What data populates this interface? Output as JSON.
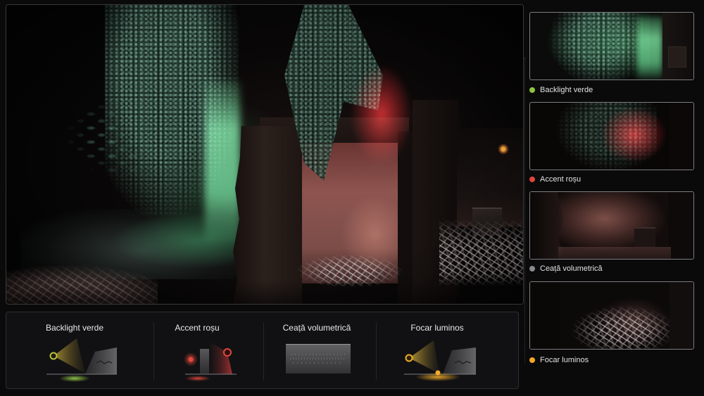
{
  "palette": {
    "background": "#0a0a0b",
    "panel": "#111113",
    "border": "#38383b"
  },
  "diagram_panel": {
    "sections": [
      {
        "label": "Backlight verde",
        "accent": "#b8c23a",
        "icon": "backlight-diagram-icon"
      },
      {
        "label": "Accent roșu",
        "accent": "#e2483c",
        "icon": "accent-light-diagram-icon"
      },
      {
        "label": "Ceață volumetrică",
        "accent": "#8e8e92",
        "icon": "fog-volume-diagram-icon"
      },
      {
        "label": "Focar luminos",
        "accent": "#f2ad2a",
        "icon": "point-light-diagram-icon"
      }
    ]
  },
  "thumbnails": [
    {
      "label": "Backlight verde",
      "dot_color": "#8cc63f"
    },
    {
      "label": "Accent roșu",
      "dot_color": "#e0453a"
    },
    {
      "label": "Ceață volumetrică",
      "dot_color": "#8a8a8e"
    },
    {
      "label": "Focar luminos",
      "dot_color": "#f5a623"
    }
  ]
}
